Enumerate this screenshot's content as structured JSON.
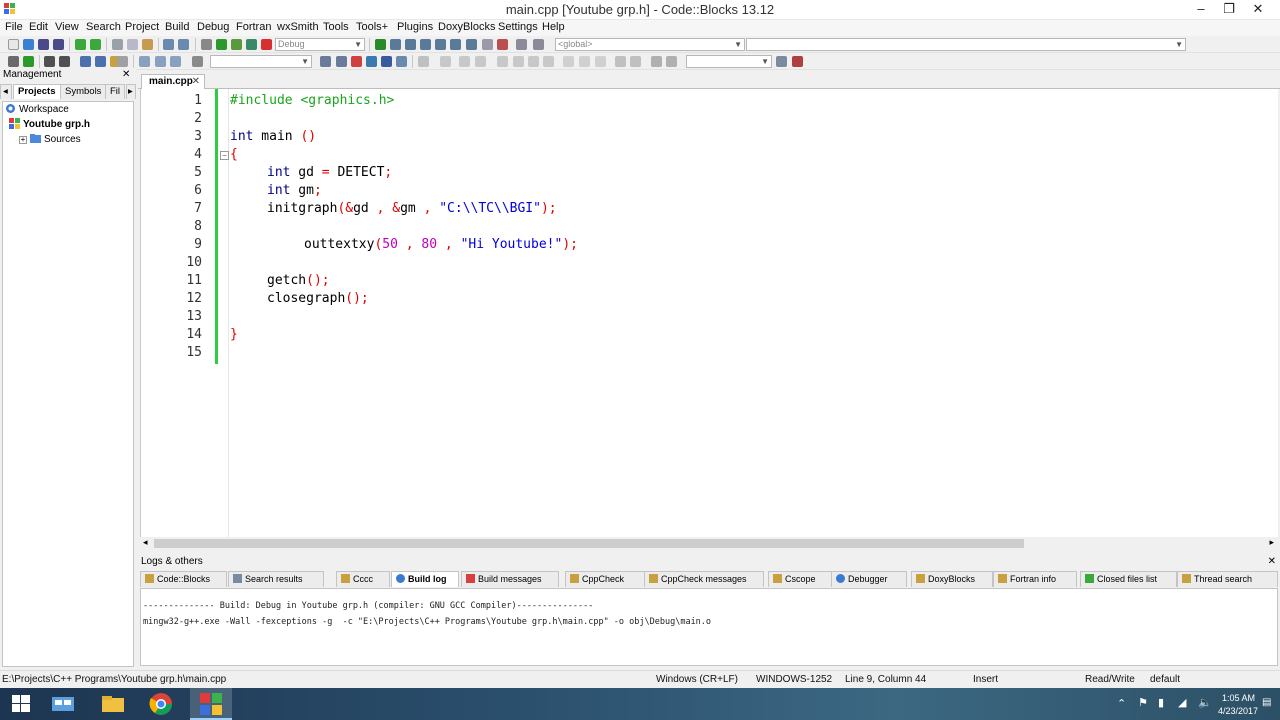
{
  "window": {
    "title": "main.cpp [Youtube grp.h] - Code::Blocks 13.12",
    "min": "–",
    "max": "❐",
    "close": "✕"
  },
  "menu": [
    "File",
    "Edit",
    "View",
    "Search",
    "Project",
    "Build",
    "Debug",
    "Fortran",
    "wxSmith",
    "Tools",
    "Tools+",
    "Plugins",
    "DoxyBlocks",
    "Settings",
    "Help"
  ],
  "toolbar": {
    "build_target": "Debug",
    "scope": "<global>"
  },
  "management": {
    "title": "Management",
    "tabs": [
      "Projects",
      "Symbols",
      "Fil"
    ],
    "tree": {
      "workspace": "Workspace",
      "project": "Youtube grp.h",
      "sources": "Sources"
    }
  },
  "editor": {
    "tab": "main.cpp",
    "line_numbers": [
      "1",
      "2",
      "3",
      "4",
      "5",
      "6",
      "7",
      "8",
      "9",
      "10",
      "11",
      "12",
      "13",
      "14",
      "15"
    ],
    "code": {
      "l1": "#include <graphics.h>",
      "l3_kw": "int",
      "l3_name": " main ",
      "l3_paren": "()",
      "l4": "{",
      "l5_kw": "int",
      "l5_rest": " gd ",
      "l5_eq": "=",
      "l5_val": " DETECT",
      "l5_semi": ";",
      "l6_kw": "int",
      "l6_rest": " gm",
      "l6_semi": ";",
      "l7_fn": "initgraph",
      "l7_p1": "(&",
      "l7_a1": "gd ",
      "l7_c1": ",",
      "l7_sp": " ",
      "l7_amp": "&",
      "l7_a2": "gm ",
      "l7_c2": ",",
      "l7_str": " \"C:\\\\TC\\\\BGI\"",
      "l7_end": ");",
      "l9_fn": "outtextxy",
      "l9_p": "(",
      "l9_n1": "50",
      "l9_c1": " , ",
      "l9_n2": "80",
      "l9_c2": " , ",
      "l9_str": "\"Hi Youtube!\"",
      "l9_end": ");",
      "l11_fn": "getch",
      "l11_end": "();",
      "l12_fn": "closegraph",
      "l12_end": "();",
      "l14": "}"
    }
  },
  "logs": {
    "title": "Logs & others",
    "tabs": [
      "Code::Blocks",
      "Search results",
      "Cccc",
      "Build log",
      "Build messages",
      "CppCheck",
      "CppCheck messages",
      "Cscope",
      "Debugger",
      "DoxyBlocks",
      "Fortran info",
      "Closed files list",
      "Thread search"
    ],
    "lines": [
      "-------------- Build: Debug in Youtube grp.h (compiler: GNU GCC Compiler)---------------",
      "mingw32-g++.exe -Wall -fexceptions -g  -c \"E:\\Projects\\C++ Programs\\Youtube grp.h\\main.cpp\" -o obj\\Debug\\main.o"
    ]
  },
  "status": {
    "path": "E:\\Projects\\C++ Programs\\Youtube grp.h\\main.cpp",
    "eol": "Windows (CR+LF)",
    "encoding": "WINDOWS-1252",
    "position": "Line 9, Column 44",
    "mode": "Insert",
    "access": "Read/Write",
    "profile": "default"
  },
  "taskbar": {
    "time": "1:05 AM",
    "date": "4/23/2017"
  },
  "colors": {
    "fold_green": "#2ecc40",
    "keyword": "#00008b",
    "preprocessor": "#1aa51a",
    "operator": "#e00000",
    "number": "#c000c0",
    "string": "#0000e0"
  }
}
